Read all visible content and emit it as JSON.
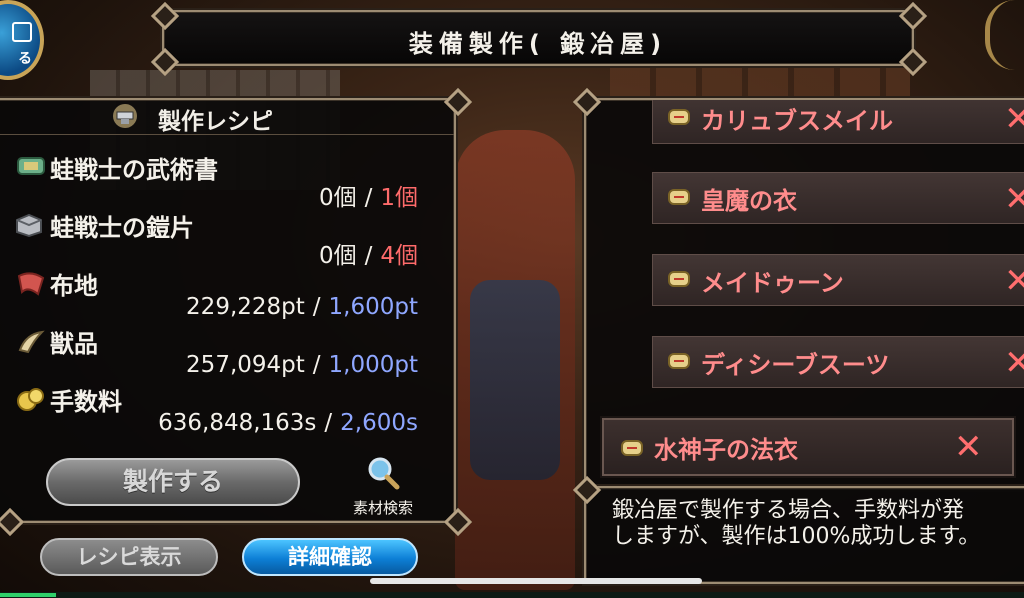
{
  "title": "装備製作( 鍛冶屋)",
  "top_left_button": {
    "label": "る"
  },
  "recipe": {
    "header": "製作レシピ",
    "materials": [
      {
        "name": "蛙戦士の武術書",
        "have": "0個",
        "need": "1個",
        "need_color": "red",
        "icon": "book-icon"
      },
      {
        "name": "蛙戦士の鎧片",
        "have": "0個",
        "need": "4個",
        "need_color": "red",
        "icon": "armor-piece-icon"
      },
      {
        "name": "布地",
        "have": "229,228pt",
        "need": "1,600pt",
        "need_color": "blue",
        "icon": "cloth-icon"
      },
      {
        "name": "獣品",
        "have": "257,094pt",
        "need": "1,000pt",
        "need_color": "blue",
        "icon": "fang-icon"
      },
      {
        "name": "手数料",
        "have": "636,848,163s",
        "need": "2,600s",
        "need_color": "blue",
        "icon": "coins-icon"
      }
    ],
    "separator": "/",
    "make_button": "製作する",
    "search_label": "素材検索"
  },
  "buttons": {
    "recipe_view": "レシピ表示",
    "detail": "詳細確認"
  },
  "equipment_list": [
    {
      "name": "カリュブスメイル"
    },
    {
      "name": "皇魔の衣"
    },
    {
      "name": "メイドゥーン"
    },
    {
      "name": "ディシーブスーツ"
    }
  ],
  "selected_item": {
    "name": "水神子の法衣"
  },
  "remove_mark": "✕",
  "description": {
    "line1": "鍛冶屋で製作する場合、手数料が発",
    "line2": "しますが、製作は100%成功します。"
  },
  "colors": {
    "need_red": "#ff6b6b",
    "need_blue": "#8fa7ff",
    "item_text": "#ff8c8c",
    "detail_button": "#0d7fd6"
  }
}
